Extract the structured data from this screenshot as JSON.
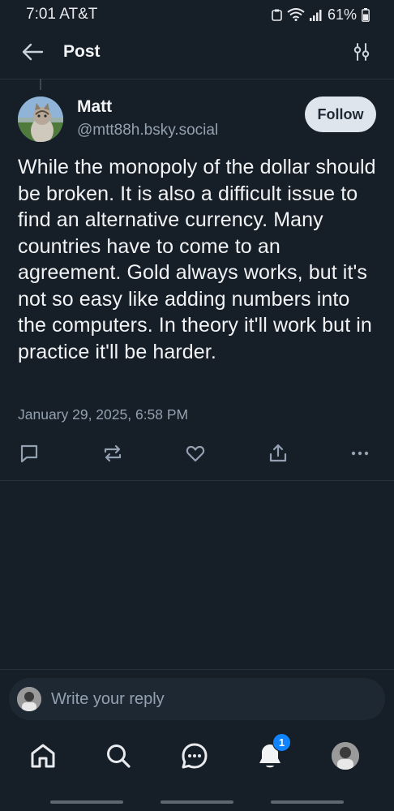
{
  "status_bar": {
    "time": "7:01 AT&T",
    "battery": "61%"
  },
  "header": {
    "title": "Post",
    "back_icon": "arrow-left-icon",
    "filter_icon": "sliders-icon"
  },
  "post": {
    "author_name": "Matt",
    "author_handle": "@mtt88h.bsky.social",
    "follow_label": "Follow",
    "text": "While the monopoly of the dollar should be broken. It is also a difficult issue to find an alternative currency. Many countries have to come to an agreement. Gold always works, but it's not so easy like adding numbers into the computers. In theory it'll work but in practice it'll be harder.",
    "timestamp": "January 29, 2025, 6:58 PM",
    "actions": [
      "reply-icon",
      "repost-icon",
      "like-icon",
      "share-icon",
      "more-icon"
    ]
  },
  "reply": {
    "placeholder": "Write your reply"
  },
  "nav": {
    "items": [
      "home-icon",
      "search-icon",
      "chat-icon",
      "notifications-icon",
      "profile-avatar"
    ],
    "notification_count": "1"
  },
  "colors": {
    "background": "#161e27",
    "accent": "#1083fe",
    "muted": "#93a1b0"
  }
}
